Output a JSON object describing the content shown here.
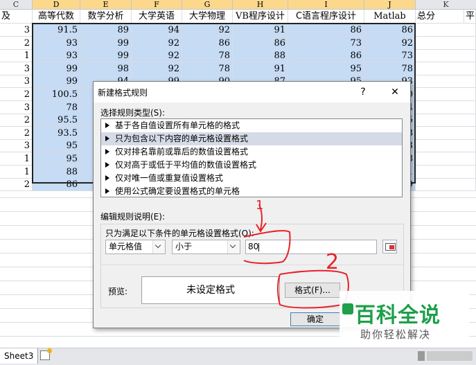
{
  "columns": [
    "C",
    "D",
    "E",
    "F",
    "G",
    "H",
    "I",
    "J",
    "K"
  ],
  "headers": [
    "高等代数",
    "数学分析",
    "大学英语",
    "大学物理",
    "VB程序设计",
    "C语言程序设计",
    "Matlab",
    "总分",
    "平"
  ],
  "left_partial_header": "及",
  "rows": [
    {
      "c": "3",
      "d": "91.5",
      "e": "89",
      "f": "94",
      "g": "92",
      "h": "91",
      "i": "86",
      "j": "86"
    },
    {
      "c": "2",
      "d": "93",
      "e": "99",
      "f": "92",
      "g": "86",
      "h": "86",
      "i": "73",
      "j": "92"
    },
    {
      "c": "1",
      "d": "93",
      "e": "99",
      "f": "92",
      "g": "78",
      "h": "88",
      "i": "86",
      "j": "73"
    },
    {
      "c": "3",
      "d": "99",
      "e": "98",
      "f": "92",
      "g": "78",
      "h": "91",
      "i": "95",
      "j": "78"
    },
    {
      "c": "3",
      "d": "99",
      "e": "94",
      "f": "99",
      "g": "90",
      "h": "87",
      "i": "95",
      "j": "93"
    },
    {
      "c": "2",
      "d": "100.5",
      "e": "",
      "f": "",
      "g": "",
      "h": "",
      "i": "",
      "j": "0"
    },
    {
      "c": "3",
      "d": "78",
      "e": "",
      "f": "",
      "g": "",
      "h": "",
      "i": "",
      "j": "4"
    },
    {
      "c": "2",
      "d": "95.5",
      "e": "",
      "f": "",
      "g": "",
      "h": "",
      "i": "",
      "j": "5"
    },
    {
      "c": "2",
      "d": "93.5",
      "e": "",
      "f": "",
      "g": "",
      "h": "",
      "i": "",
      "j": "8"
    },
    {
      "c": "3",
      "d": "95",
      "e": "",
      "f": "",
      "g": "",
      "h": "",
      "i": "",
      "j": "3"
    },
    {
      "c": "1",
      "d": "95",
      "e": "",
      "f": "",
      "g": "",
      "h": "",
      "i": "",
      "j": "8"
    },
    {
      "c": "1",
      "d": "88",
      "e": "",
      "f": "",
      "g": "",
      "h": "",
      "i": "",
      "j": "1"
    },
    {
      "c": "2",
      "d": "86",
      "e": "",
      "f": "",
      "g": "",
      "h": "",
      "i": "",
      "j": "9"
    }
  ],
  "dialog": {
    "title": "新建格式规则",
    "help": "?",
    "close": "✕",
    "rule_type_label": "选择规则类型(S):",
    "rule_types": [
      "基于各自值设置所有单元格的格式",
      "只为包含以下内容的单元格设置格式",
      "仅对排名靠前或靠后的数值设置格式",
      "仅对高于或低于平均值的数值设置格式",
      "仅对唯一值或重复值设置格式",
      "使用公式确定要设置格式的单元格"
    ],
    "selected_index": 1,
    "edit_label": "编辑规则说明(E):",
    "condition_label": "只为满足以下条件的单元格设置格式(O):",
    "combo1": "单元格值",
    "combo2": "小于",
    "value": "80",
    "preview_label": "预览:",
    "preview_text": "未设定格式",
    "format_button": "格式(F)...",
    "ok_button": "确定"
  },
  "annotations": {
    "one": "1",
    "two": "2"
  },
  "sheet_tab": "Sheet3",
  "watermark": {
    "title": "百科全说",
    "subtitle": "助你轻松解决"
  },
  "colors": {
    "selection": "#c6dbf4",
    "annotation": "#e8202a",
    "watermark": "#1e9f4a"
  }
}
